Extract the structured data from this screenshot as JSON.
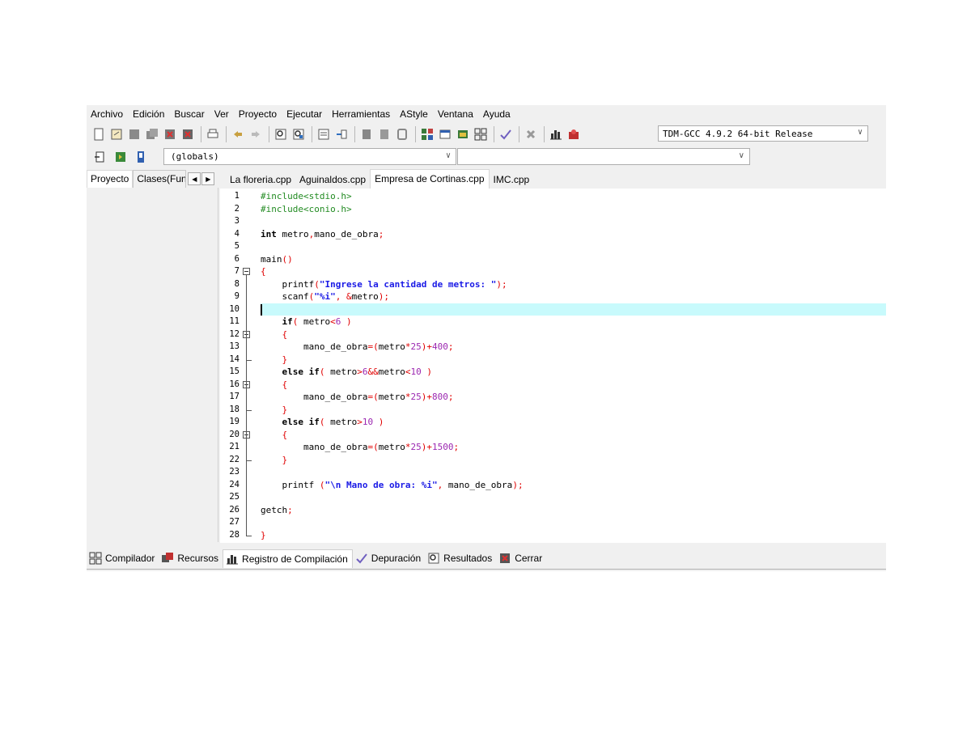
{
  "menu": [
    "Archivo",
    "Edición",
    "Buscar",
    "Ver",
    "Proyecto",
    "Ejecutar",
    "Herramientas",
    "AStyle",
    "Ventana",
    "Ayuda"
  ],
  "compiler": {
    "selected": "TDM-GCC 4.9.2 64-bit Release"
  },
  "scope": {
    "selected": "(globals)"
  },
  "left_tabs": [
    "Proyecto",
    "Clases(Fun"
  ],
  "file_tabs": [
    {
      "label": "La floreria.cpp",
      "active": false
    },
    {
      "label": "Aguinaldos.cpp",
      "active": false
    },
    {
      "label": "Empresa de Cortinas.cpp",
      "active": true
    },
    {
      "label": "IMC.cpp",
      "active": false
    }
  ],
  "editor": {
    "line_numbers": [
      "1",
      "2",
      "3",
      "4",
      "5",
      "6",
      "7",
      "8",
      "9",
      "10",
      "11",
      "12",
      "13",
      "14",
      "15",
      "16",
      "17",
      "18",
      "19",
      "20",
      "21",
      "22",
      "23",
      "24",
      "25",
      "26",
      "27",
      "28"
    ],
    "current_line": "10",
    "code_lines": [
      "#include<stdio.h>",
      "#include<conio.h>",
      "",
      "int metro,mano_de_obra;",
      "",
      "main()",
      "{",
      "    printf(\"Ingrese la cantidad de metros: \");",
      "    scanf(\"%i\", &metro);",
      "",
      "    if( metro<6 )",
      "    {",
      "        mano_de_obra=(metro*25)+400;",
      "    }",
      "    else if( metro>6&&metro<10 )",
      "    {",
      "        mano_de_obra=(metro*25)+800;",
      "    }",
      "    else if( metro>10 )",
      "    {",
      "        mano_de_obra=(metro*25)+1500;",
      "    }",
      "",
      "    printf (\"\\n Mano de obra: %i\", mano_de_obra);",
      "",
      "getch;",
      "",
      "}"
    ]
  },
  "bottom_tabs": [
    {
      "label": "Compilador",
      "icon": "compiler-grid-icon"
    },
    {
      "label": "Recursos",
      "icon": "resources-icon"
    },
    {
      "label": "Registro de Compilación",
      "icon": "bar-chart-icon"
    },
    {
      "label": "Depuración",
      "icon": "check-icon"
    },
    {
      "label": "Resultados",
      "icon": "search-results-icon"
    },
    {
      "label": "Cerrar",
      "icon": "close-window-icon"
    }
  ],
  "colors": {
    "keyword": "#000000",
    "preprocessor": "#228b22",
    "symbol": "#e00000",
    "string": "#1a1ae6",
    "number": "#9b27b0",
    "current_line": "#c8fafc"
  }
}
